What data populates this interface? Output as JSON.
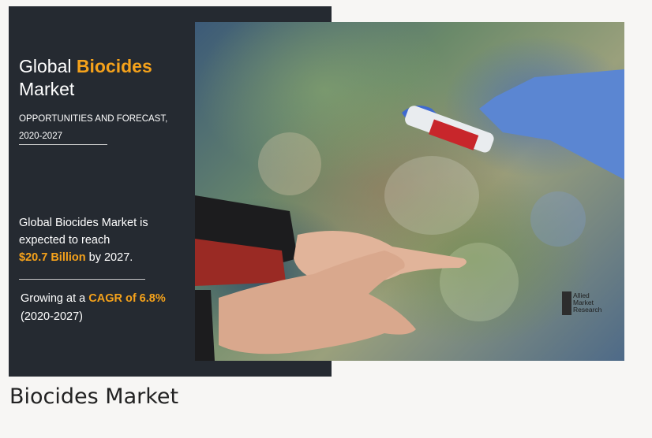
{
  "banner": {
    "title_pre": "Global ",
    "title_accent": "Biocides",
    "title_post": "Market",
    "subtitle": "OPPORTUNITIES AND FORECAST, 2020-2027",
    "stat1_pre": "Global Biocides Market is expected to reach",
    "stat1_value": "$20.7 Billion",
    "stat1_post": " by 2027.",
    "stat2_pre": "Growing at a ",
    "stat2_value": "CAGR of 6.8%",
    "stat2_post": "(2020-2027)"
  },
  "logo": {
    "line1": "Allied",
    "line2": "Market",
    "line3": "Research"
  },
  "caption": "Biocides Market",
  "colors": {
    "accent": "#f5a21b",
    "panel": "#252a31",
    "page_bg": "#f7f6f4"
  },
  "icons": {
    "logo_mark": "allied-market-research-logo-icon"
  }
}
